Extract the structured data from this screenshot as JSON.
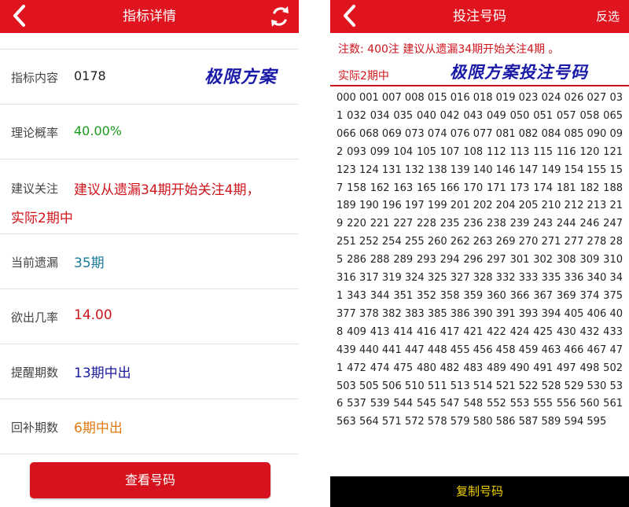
{
  "left": {
    "title": "指标详情",
    "banner": "极限方案",
    "rows": [
      {
        "label": "指标内容",
        "value": "0178",
        "color": "#222222"
      },
      {
        "label": "理论概率",
        "value": "40.00%",
        "color": "#1a9a1a"
      },
      {
        "label": "建议关注",
        "value": "建议从遗漏34期开始关注4期，",
        "value2": "实际2期中",
        "color": "#d0141c"
      },
      {
        "label": "当前遗漏",
        "value": "35期",
        "color": "#1a7a9a"
      },
      {
        "label": "欲出几率",
        "value": "14.00",
        "color": "#d0141c"
      },
      {
        "label": "提醒期数",
        "value": "13期中出",
        "color": "#1a1a9a"
      },
      {
        "label": "回补期数",
        "value": "6期中出",
        "color": "#e07a10"
      }
    ],
    "view_button": "查看号码"
  },
  "right": {
    "title": "投注号码",
    "invert_button": "反选",
    "info_line1": "注数: 400注 建议从遗漏34期开始关注4期 。",
    "info_line2": "实际2期中",
    "banner": "极限方案投注号码",
    "numbers": "000 001 007 008 015 016 018 019 023 024 026 027 031 032 034 035 040 042 043 049 050 051 057 058 065 066 068 069 073 074 076 077 081 082 084 085 090 092 093 099 104 105 107 108 112 113 115 116 120 121 123 124 131 132 138 139 140 146 147 149 154 155 157 158 162 163 165 166 170 171 173 174 181 182 188 189 190 196 197 199 201 202 204 205 210 212 213 219 220 221 227 228 235 236 238 239 243 244 246 247 251 252 254 255 260 262 263 269 270 271 277 278 285 286 288 289 293 294 296 297 301 302 308 309 310 316 317 319 324 325 327 328 332 333 335 336 340 341 343 344 351 352 358 359 360 366 367 369 374 375 377 378 382 383 385 386 390 391 393 394 405 406 408 409 413 414 416 417 421 422 424 425 430 432 433 439 440 441 447 448 455 456 458 459 463 466 467 471 472 474 475 480 482 483 489 490 491 497 498 502 503 505 506 510 511 513 514 521 522 528 529 530 536 537 539 544 545 547 548 552 553 555 556 560 561 563 564 571 572 578 579 580 586 587 589 594 595",
    "copy_button": "复制号码"
  },
  "colors": {
    "topbar": "#e0141e",
    "button": "#d5121d",
    "banner": "#1a1aa8",
    "copy_text": "#f0d000"
  }
}
